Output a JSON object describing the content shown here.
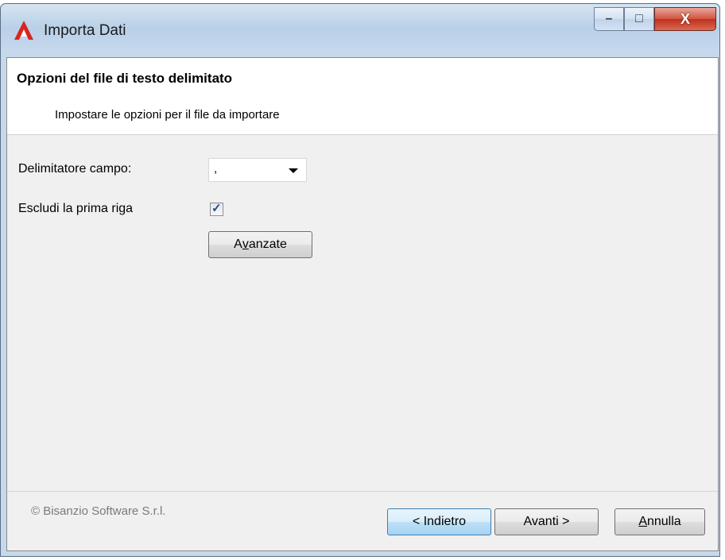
{
  "window": {
    "title": "Importa Dati",
    "controls": {
      "minimize": "–",
      "maximize": "□",
      "close": "X"
    }
  },
  "header": {
    "title": "Opzioni del file di testo delimitato",
    "subtitle": "Impostare le opzioni per il file da importare"
  },
  "form": {
    "delimiter_label": "Delimitatore campo:",
    "delimiter_value": ",",
    "skip_first_row_label": "Escludi la prima riga",
    "skip_first_row_checked": true,
    "advanced_button": {
      "pre": "A",
      "accel": "v",
      "post": "anzate"
    }
  },
  "footer": {
    "copyright": "© Bisanzio Software S.r.l.",
    "back_button": "< Indietro",
    "next_button": "Avanti >",
    "cancel_button": {
      "accel": "A",
      "post": "nnulla"
    }
  },
  "colors": {
    "accent_button": "#a7d3f2",
    "close_button": "#c0301d",
    "app_icon": "#d8261c"
  }
}
